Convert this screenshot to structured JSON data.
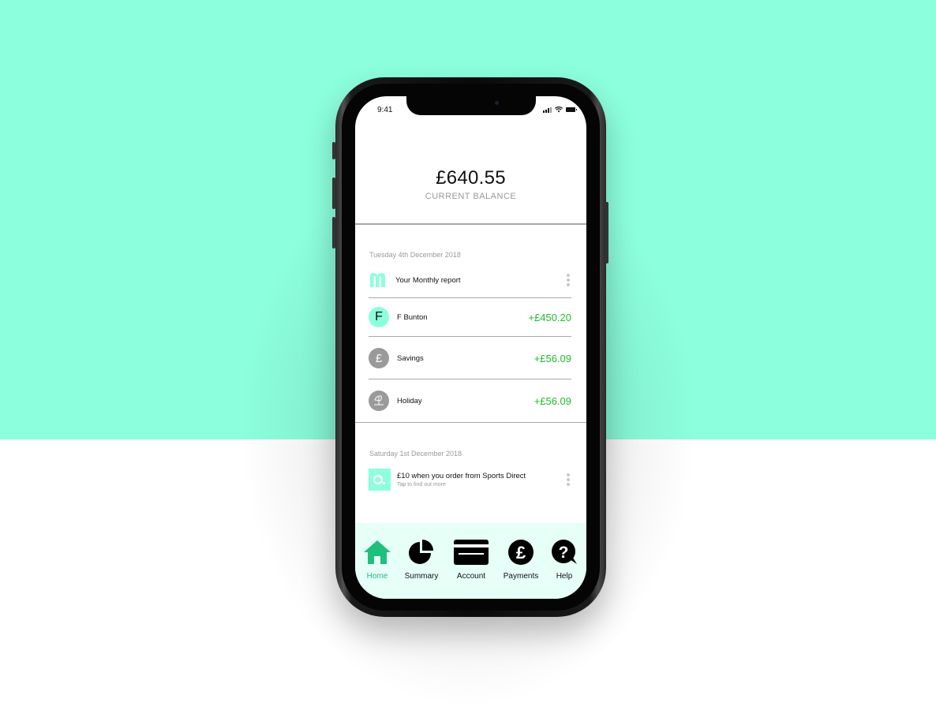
{
  "status_bar": {
    "time": "9:41"
  },
  "balance": {
    "amount": "£640.55",
    "label": "CURRENT BALANCE"
  },
  "sections": [
    {
      "date": "Tuesday 4th December 2018",
      "items": [
        {
          "icon": "monzo-m-logo",
          "label": "Your Monthly report",
          "amount": null,
          "menu": true
        },
        {
          "icon": "F",
          "label": "F Bunton",
          "amount": "+£450.20"
        },
        {
          "icon": "pound-icon",
          "label": "Savings",
          "amount": "+£56.09"
        },
        {
          "icon": "umbrella-beach-icon",
          "label": "Holiday",
          "amount": "+£56.09"
        }
      ]
    },
    {
      "date": "Saturday 1st December 2018",
      "items": [
        {
          "icon": "offer-logo",
          "label": "£10 when you order from Sports Direct",
          "sublabel": "Tap to find out more",
          "menu": true
        }
      ]
    }
  ],
  "tabbar": {
    "tabs": [
      {
        "label": "Home",
        "icon": "home-icon",
        "active": true
      },
      {
        "label": "Summary",
        "icon": "pie-chart-icon",
        "active": false
      },
      {
        "label": "Account",
        "icon": "card-icon",
        "active": false
      },
      {
        "label": "Payments",
        "icon": "pound-coin-icon",
        "active": false
      },
      {
        "label": "Help",
        "icon": "help-icon",
        "active": false
      }
    ]
  },
  "colors": {
    "accent": "#8cffdc",
    "active_tab": "#1fbf7e",
    "positive_amount": "#1fbf2a",
    "tabbar_bg": "#e6fff7"
  }
}
